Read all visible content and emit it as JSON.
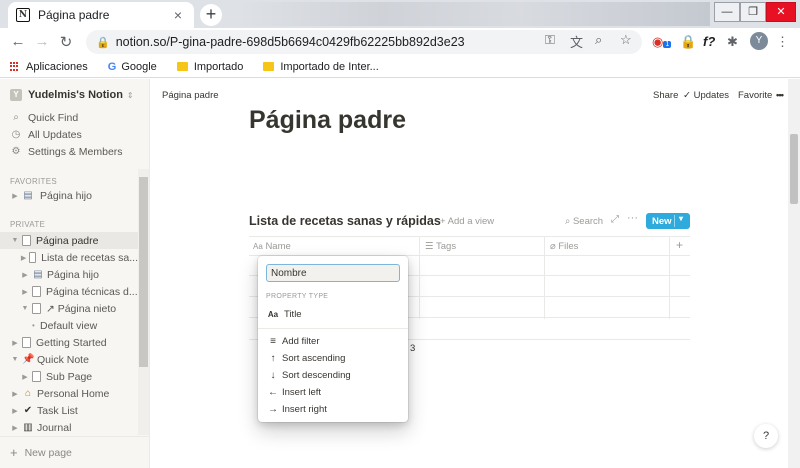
{
  "browser": {
    "tab_title": "Página padre",
    "tab_favicon": "N",
    "url": "notion.so/P-gina-padre-698d5b6694c0429fb62225bb892d3e23",
    "avatar_letter": "Y",
    "bookmarks": [
      {
        "label": "Aplicaciones",
        "icon": "apps-grid-icon"
      },
      {
        "label": "Google",
        "icon": "google-icon"
      },
      {
        "label": "Importado",
        "icon": "folder-icon"
      },
      {
        "label": "Importado de Inter...",
        "icon": "folder-icon"
      }
    ],
    "extension_badge": "1",
    "ext_label": "f?"
  },
  "sidebar": {
    "workspace": "Yudelmis's Notion",
    "workspace_logo": "Y",
    "top_items": [
      {
        "label": "Quick Find",
        "icon": "search-icon"
      },
      {
        "label": "All Updates",
        "icon": "clock-icon"
      },
      {
        "label": "Settings & Members",
        "icon": "gear-icon"
      }
    ],
    "favorites_label": "FAVORITES",
    "favorites": [
      {
        "label": "Página hijo"
      }
    ],
    "private_label": "PRIVATE",
    "pages": [
      {
        "label": "Página padre"
      },
      {
        "label": "Lista de recetas sa..."
      },
      {
        "label": "Página hijo"
      },
      {
        "label": "Página técnicas d..."
      },
      {
        "label": "↗ Página nieto"
      },
      {
        "label": "Default view"
      },
      {
        "label": "Getting Started"
      },
      {
        "label": "Quick Note"
      },
      {
        "label": "Sub Page"
      },
      {
        "label": "Personal Home"
      },
      {
        "label": "Task List"
      },
      {
        "label": "Journal"
      }
    ],
    "new_page": "New page"
  },
  "topbar": {
    "breadcrumb": "Página padre",
    "share": "Share",
    "updates": "Updates",
    "favorite": "Favorite",
    "more": "•••"
  },
  "page": {
    "title": "Página padre"
  },
  "database": {
    "title": "Lista de recetas sanas y rápidas",
    "add_view": "+ Add a view",
    "search": "Search",
    "new_button": "New",
    "columns": [
      {
        "label": "Name",
        "icon": "Aa"
      },
      {
        "label": "Tags",
        "icon": "list-icon"
      },
      {
        "label": "Files",
        "icon": "paperclip-icon"
      }
    ],
    "add_column": "+",
    "count": "3"
  },
  "property_menu": {
    "name_value": "Nombre",
    "section_label": "PROPERTY TYPE",
    "type": {
      "label": "Title",
      "icon": "Aa"
    },
    "actions": [
      {
        "label": "Add filter",
        "icon": "filter-icon"
      },
      {
        "label": "Sort ascending",
        "icon": "arrow-up-icon"
      },
      {
        "label": "Sort descending",
        "icon": "arrow-down-icon"
      },
      {
        "label": "Insert left",
        "icon": "arrow-left-icon"
      },
      {
        "label": "Insert right",
        "icon": "arrow-right-icon"
      }
    ]
  },
  "help_label": "?"
}
